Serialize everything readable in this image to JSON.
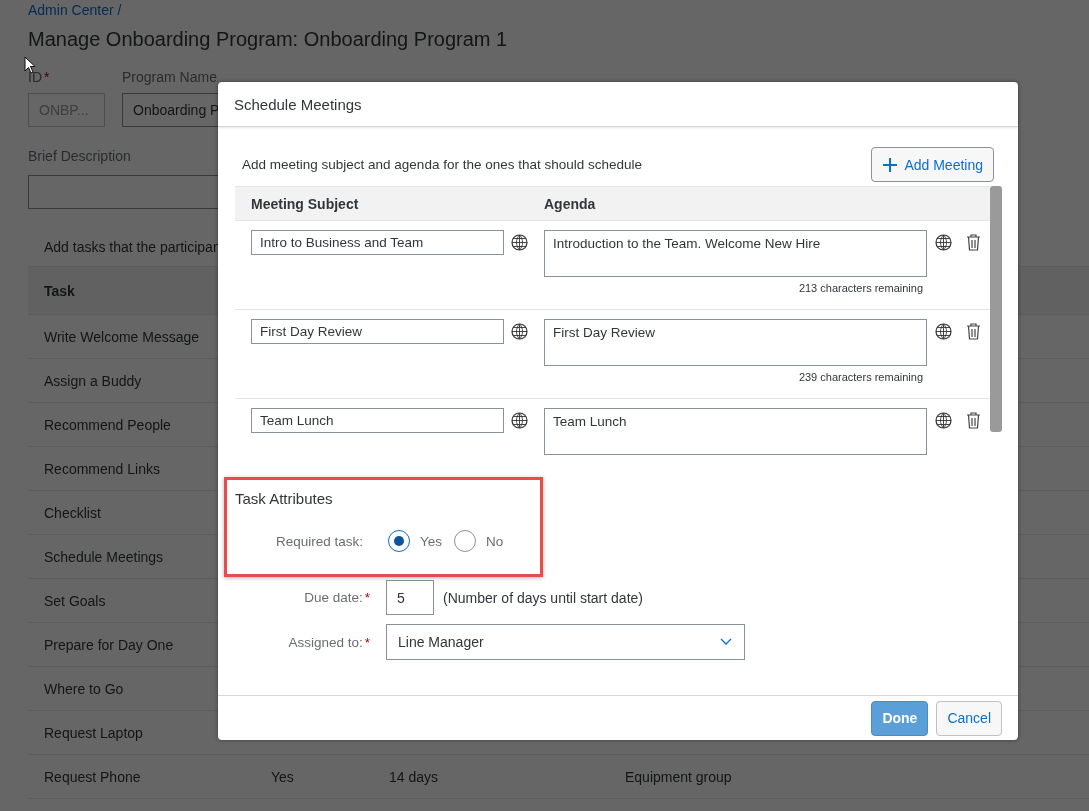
{
  "breadcrumb": "Admin Center /",
  "page_title": "Manage Onboarding Program: Onboarding Program 1",
  "id_field": {
    "label": "ID",
    "required_mark": "*",
    "value": "ONBP...",
    "disabled": true
  },
  "program_name_field": {
    "label": "Program Name",
    "value": "Onboarding P"
  },
  "brief_description": {
    "label": "Brief Description"
  },
  "tasks_table": {
    "instruction": "Add tasks that the participan",
    "columns": [
      "Task"
    ],
    "rows": [
      {
        "task": "Write Welcome Message"
      },
      {
        "task": "Assign a Buddy"
      },
      {
        "task": "Recommend People"
      },
      {
        "task": "Recommend Links"
      },
      {
        "task": "Checklist"
      },
      {
        "task": "Schedule Meetings"
      },
      {
        "task": "Set Goals"
      },
      {
        "task": "Prepare for Day One"
      },
      {
        "task": "Where to Go"
      },
      {
        "task": "Request Laptop"
      },
      {
        "task": "Request Phone",
        "column_2": "Yes",
        "column_3": "14 days",
        "column_4": "Equipment group"
      }
    ]
  },
  "dialog": {
    "title": "Schedule Meetings",
    "instruction": "Add meeting subject and agenda for the ones that should schedule",
    "add_button": "Add Meeting",
    "columns": [
      "Meeting Subject",
      "Agenda"
    ],
    "meetings": [
      {
        "subject": "Intro to Business and Team",
        "agenda": "Introduction to the Team. Welcome New Hire",
        "remaining": "213 characters remaining"
      },
      {
        "subject": "First Day Review",
        "agenda": "First Day Review",
        "remaining": "239 characters remaining"
      },
      {
        "subject": "Team Lunch",
        "agenda": "Team Lunch"
      }
    ],
    "task_attributes": {
      "title": "Task Attributes",
      "required_task": {
        "label": "Required task:",
        "options": [
          {
            "label": "Yes",
            "selected": true
          },
          {
            "label": "No",
            "selected": false
          }
        ]
      },
      "due_date": {
        "label": "Due date:",
        "required_mark": "*",
        "value": "5",
        "hint": "(Number of days until start date)"
      },
      "assigned_to": {
        "label": "Assigned to:",
        "required_mark": "*",
        "value": "Line Manager"
      }
    },
    "buttons": [
      {
        "label": "Done",
        "kind": "primary"
      },
      {
        "label": "Cancel",
        "kind": "secondary"
      }
    ]
  }
}
